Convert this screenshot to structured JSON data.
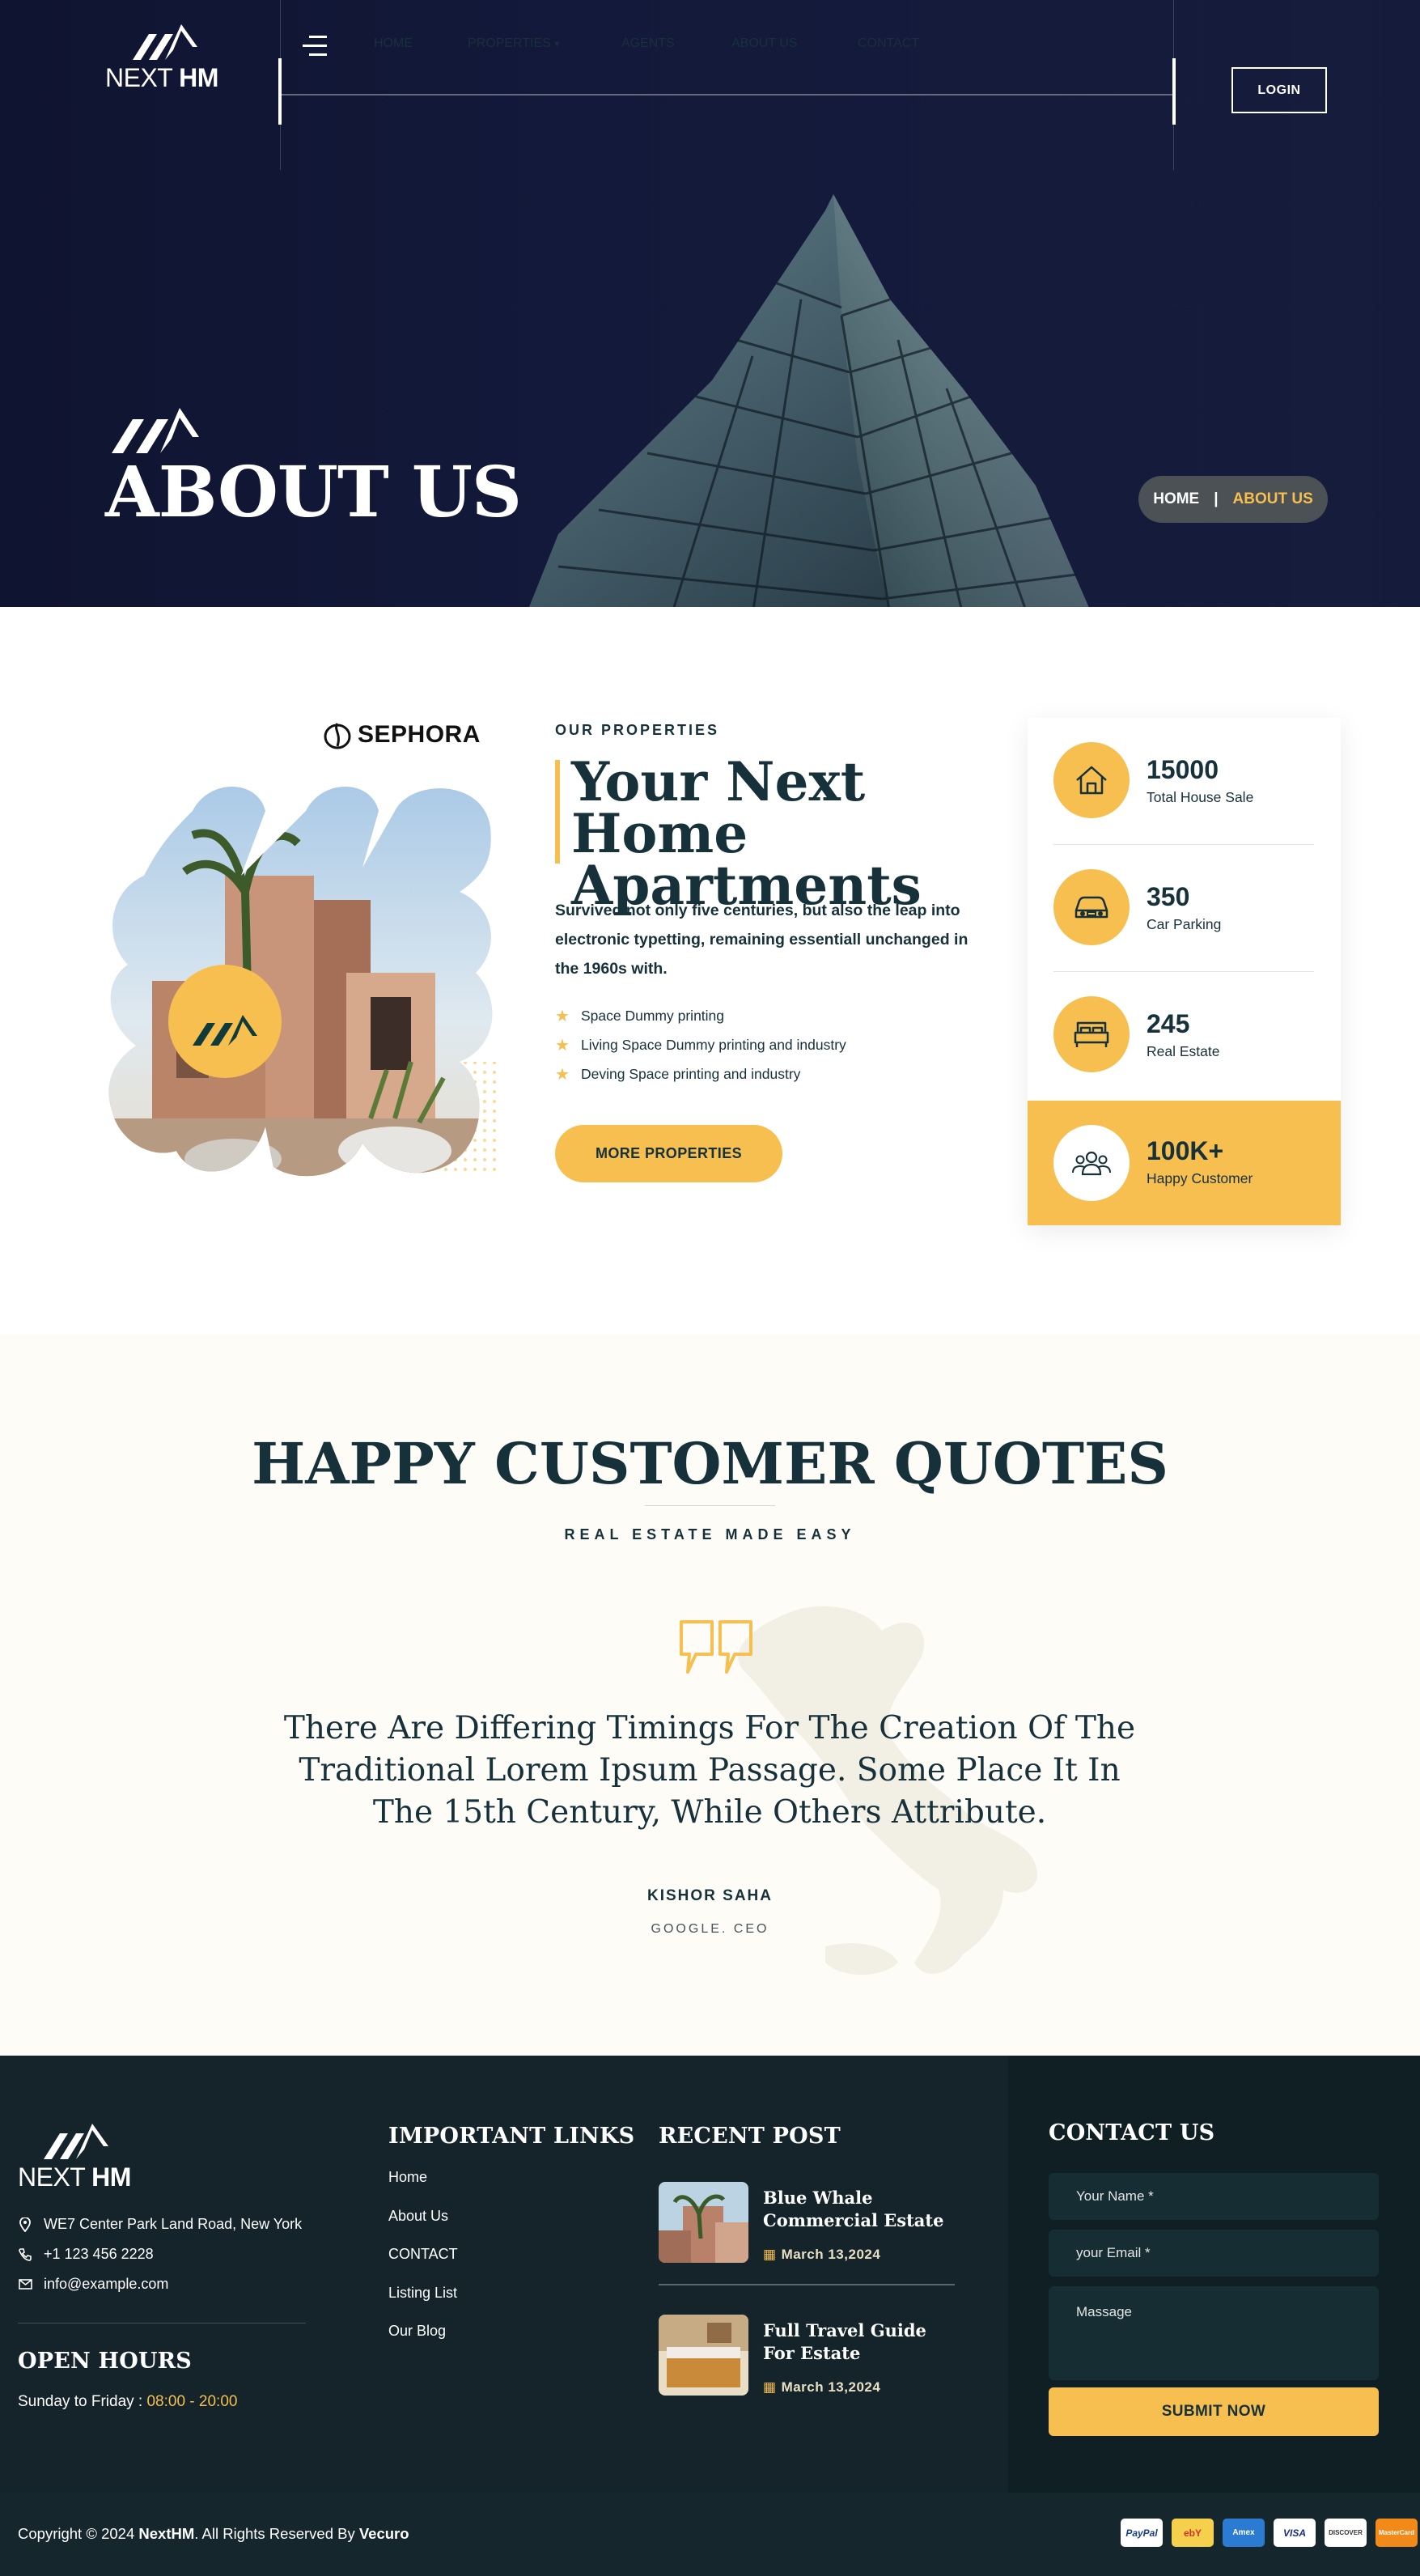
{
  "header": {
    "logo": {
      "text_light": "NEXT ",
      "text_bold": "HM"
    },
    "nav": [
      {
        "label": "HOME"
      },
      {
        "label": "PROPERTIES",
        "dropdown": true
      },
      {
        "label": "AGENTS"
      },
      {
        "label": "ABOUT US"
      },
      {
        "label": "CONTACT"
      }
    ],
    "login_label": "LOGIN",
    "menu_icon": "hamburger-menu-icon"
  },
  "hero": {
    "title": "ABOUT US",
    "breadcrumb": {
      "home": "HOME",
      "separator": "|",
      "current": "ABOUT US"
    }
  },
  "about": {
    "brand_logo": "SEPHORA",
    "eyebrow": "OUR PROPERTIES",
    "title": "Your Next Home Apartments",
    "description": "Survived not only five centuries, but also the leap into electronic typetting, remaining essentiall unchanged in the 1960s with.",
    "features": [
      "Space Dummy printing",
      "Living Space Dummy printing and industry",
      "Deving Space printing and industry"
    ],
    "button_label": "MORE PROPERTIES",
    "stats": [
      {
        "value": "15000",
        "label": "Total House Sale",
        "icon": "house-icon"
      },
      {
        "value": "350",
        "label": "Car Parking",
        "icon": "car-icon"
      },
      {
        "value": "245",
        "label": "Real Estate",
        "icon": "bed-icon"
      },
      {
        "value": "100K+",
        "label": "Happy Customer",
        "icon": "users-icon"
      }
    ]
  },
  "testimonial": {
    "title": "HAPPY CUSTOMER QUOTES",
    "subtitle": "REAL ESTATE MADE EASY",
    "quote": "There Are Differing Timings For The Creation Of The Traditional Lorem Ipsum Passage. Some Place It In The 15th Century, While Others Attribute.",
    "author": "KISHOR SAHA",
    "role": "GOOGLE. CEO"
  },
  "footer": {
    "logo": {
      "text_light": "NEXT ",
      "text_bold": "HM"
    },
    "address": "WE7 Center Park Land Road, New York",
    "phone": "+1 123 456 2228",
    "email": "info@example.com",
    "hours_heading": "OPEN HOURS",
    "hours_label": "Sunday to Friday : ",
    "hours_value": "08:00 - 20:00",
    "links_heading": "IMPORTANT LINKS",
    "links": [
      "Home",
      "About Us",
      "CONTACT",
      "Listing List",
      "Our Blog"
    ],
    "posts_heading": "RECENT POST",
    "posts": [
      {
        "title": "Blue Whale Commercial Estate",
        "date": "March 13,2024"
      },
      {
        "title": "Full Travel Guide For Estate",
        "date": "March 13,2024"
      }
    ],
    "contact_heading": "CONTACT US",
    "form": {
      "name_placeholder": "Your Name *",
      "email_placeholder": "your Email *",
      "message_placeholder": "Massage",
      "submit_label": "SUBMIT NOW"
    },
    "copyright": {
      "prefix": "Copyright © 2024 ",
      "brand": "NextHM",
      "middle": ". All Rights Reserved By ",
      "author": "Vecuro"
    },
    "payments": [
      "PayPal",
      "ebY",
      "Amex",
      "VISA",
      "DISCOVER",
      "MasterCard"
    ]
  },
  "colors": {
    "accent": "#f6bf4f",
    "dark": "#17313b",
    "hero_bg": "#13193a",
    "footer_bg": "#14242a"
  }
}
